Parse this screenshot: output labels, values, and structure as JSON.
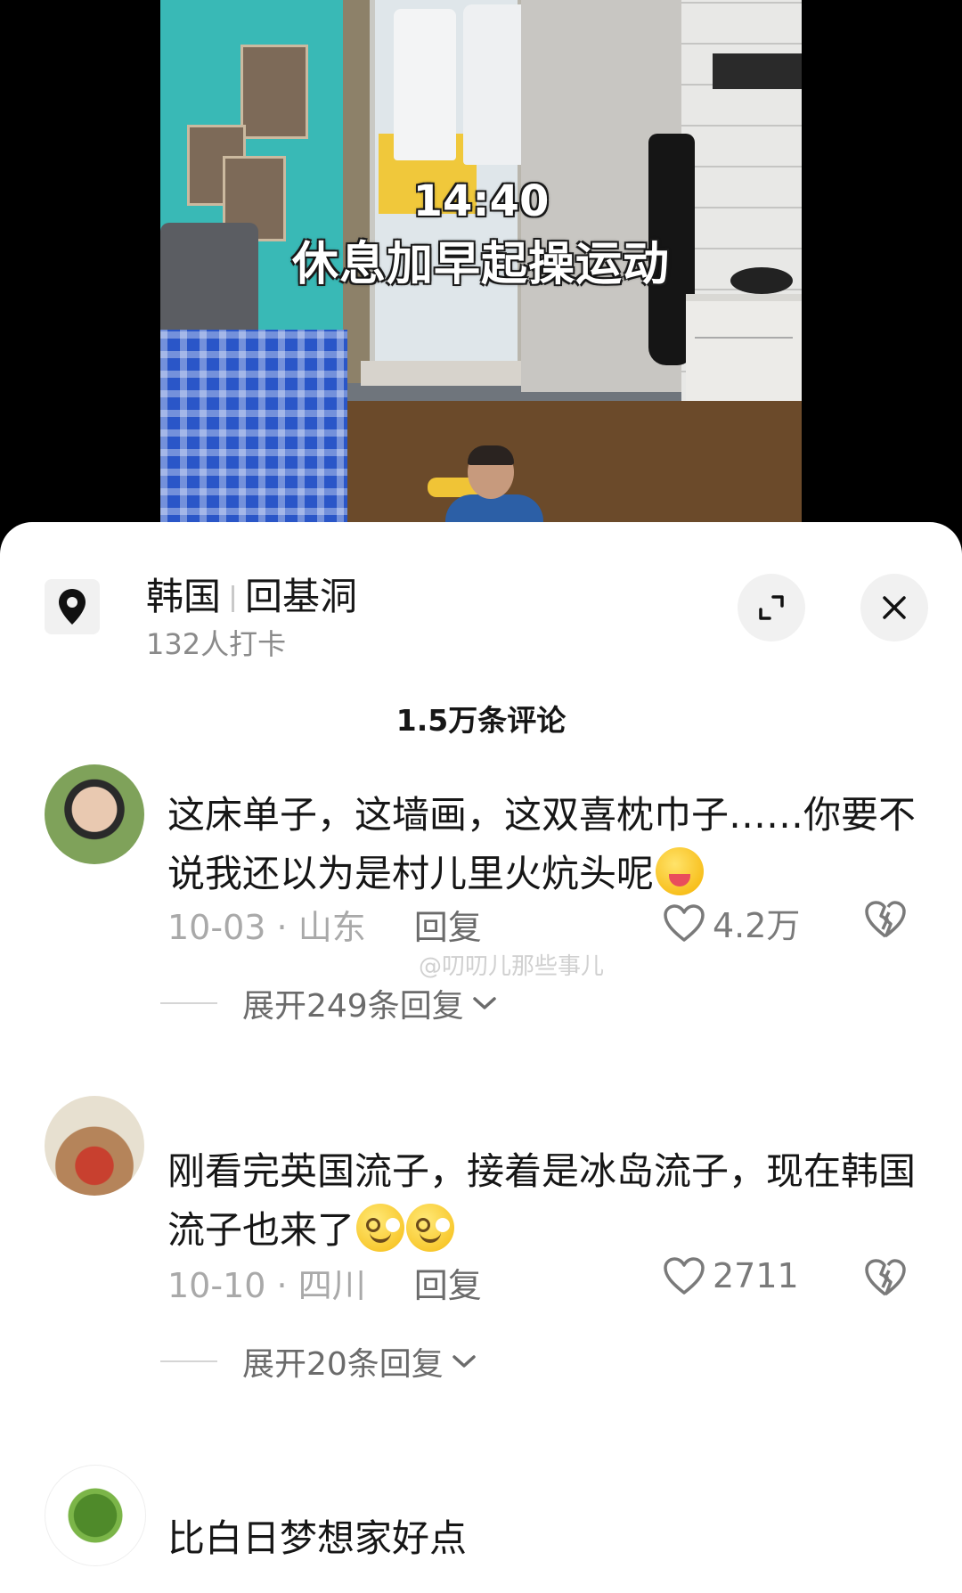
{
  "video": {
    "overlay_time": "14:40",
    "overlay_caption": "休息加早起操运动"
  },
  "location": {
    "country": "韩国",
    "place": "回基洞",
    "checkins": "132人打卡",
    "icon": "location-pin-icon"
  },
  "header_buttons": {
    "expand_icon": "expand-icon",
    "close_icon": "close-icon"
  },
  "comments_count": "1.5万条评论",
  "watermark": "@叨叨儿那些事儿",
  "comments": [
    {
      "username": "",
      "text": "这床单子，这墙画，这双喜枕巾子……你要不说我还以为是村儿里火炕头呢",
      "emoji": "yum-face-icon",
      "date": "10-03",
      "region": "山东",
      "reply_label": "回复",
      "likes": "4.2万",
      "expand_label": "展开249条回复"
    },
    {
      "username": "",
      "text": "刚看完英国流子，接着是冰岛流子，现在韩国流子也来了",
      "emoji": "smile-face-icon",
      "date": "10-10",
      "region": "四川",
      "reply_label": "回复",
      "likes": "2711",
      "expand_label": "展开20条回复"
    },
    {
      "username": "",
      "text": "比白日梦想家好点"
    }
  ]
}
